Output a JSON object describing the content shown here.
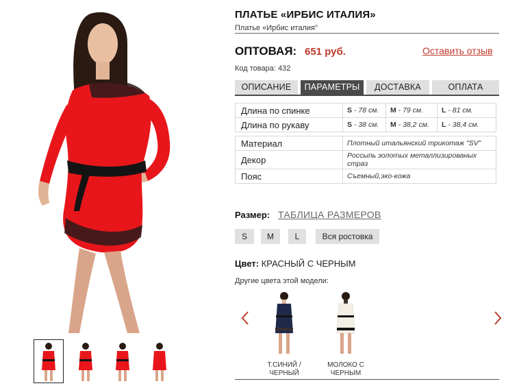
{
  "product": {
    "title": "ПЛАТЬЕ «ИРБИС ИТАЛИЯ»",
    "subtitle": "Платье «Ирбис италия\"",
    "price_label": "ОПТОВАЯ:",
    "price_value": "651 руб.",
    "review_link": "Оставить отзыв",
    "sku": "Код товара: 432"
  },
  "tabs": [
    {
      "label": "ОПИСАНИЕ",
      "active": false
    },
    {
      "label": "ПАРАМЕТРЫ",
      "active": true
    },
    {
      "label": "ДОСТАВКА",
      "active": false
    },
    {
      "label": "ОПЛАТА",
      "active": false
    }
  ],
  "measurements": [
    {
      "name": "Длина по спинке",
      "s": "- 78 см.",
      "m": "- 79 см.",
      "l": "- 81 см."
    },
    {
      "name": "Длина по рукаву",
      "s": "- 38 см.",
      "m": "- 38,2 см.",
      "l": "- 38,4 см."
    }
  ],
  "size_letters": {
    "s": "S",
    "m": "M",
    "l": "L"
  },
  "attributes": [
    {
      "name": "Материал",
      "value": "Плотный итальянский трикотаж \"SV\""
    },
    {
      "name": "Декор",
      "value": "Россыпь золотых металлизированых страз"
    },
    {
      "name": "Пояс",
      "value": "Съемный,эко-кожа"
    }
  ],
  "sizes": {
    "label": "Размер:",
    "table_link": "ТАБЛИЦА РАЗМЕРОВ",
    "options": [
      "S",
      "M",
      "L",
      "Вся ростовка"
    ]
  },
  "color": {
    "label": "Цвет:",
    "value": "КРАСНЫЙ С ЧЕРНЫМ",
    "other_label": "Другие цвета этой модели:",
    "variants": [
      {
        "name_line1": "Т.СИНИЙ /",
        "name_line2": "ЧЕРНЫЙ",
        "dress_color": "#1f2a4a"
      },
      {
        "name_line1": "МОЛОКО С",
        "name_line2": "ЧЕРНЫМ",
        "dress_color": "#f3efe6"
      }
    ]
  },
  "colors": {
    "accent": "#c0392b",
    "dress": "#e8161b",
    "tab_active": "#4a4a4a",
    "tab_inactive": "#dfdfdf",
    "button_bg": "#e0e0e0"
  }
}
